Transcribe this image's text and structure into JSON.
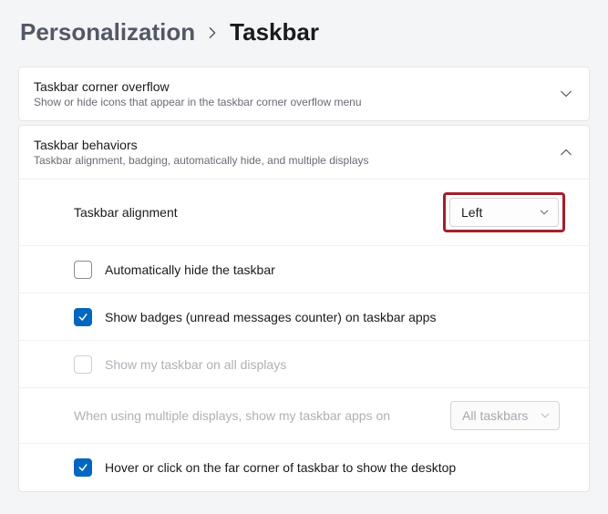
{
  "breadcrumb": {
    "parent": "Personalization",
    "current": "Taskbar"
  },
  "overflow": {
    "title": "Taskbar corner overflow",
    "subtitle": "Show or hide icons that appear in the taskbar corner overflow menu"
  },
  "behaviors": {
    "title": "Taskbar behaviors",
    "subtitle": "Taskbar alignment, badging, automatically hide, and multiple displays",
    "alignment": {
      "label": "Taskbar alignment",
      "value": "Left"
    },
    "autohide": {
      "label": "Automatically hide the taskbar"
    },
    "badges": {
      "label": "Show badges (unread messages counter) on taskbar apps"
    },
    "alldisplays": {
      "label": "Show my taskbar on all displays"
    },
    "multidisplay": {
      "label": "When using multiple displays, show my taskbar apps on",
      "value": "All taskbars"
    },
    "farcorner": {
      "label": "Hover or click on the far corner of taskbar to show the desktop"
    }
  }
}
